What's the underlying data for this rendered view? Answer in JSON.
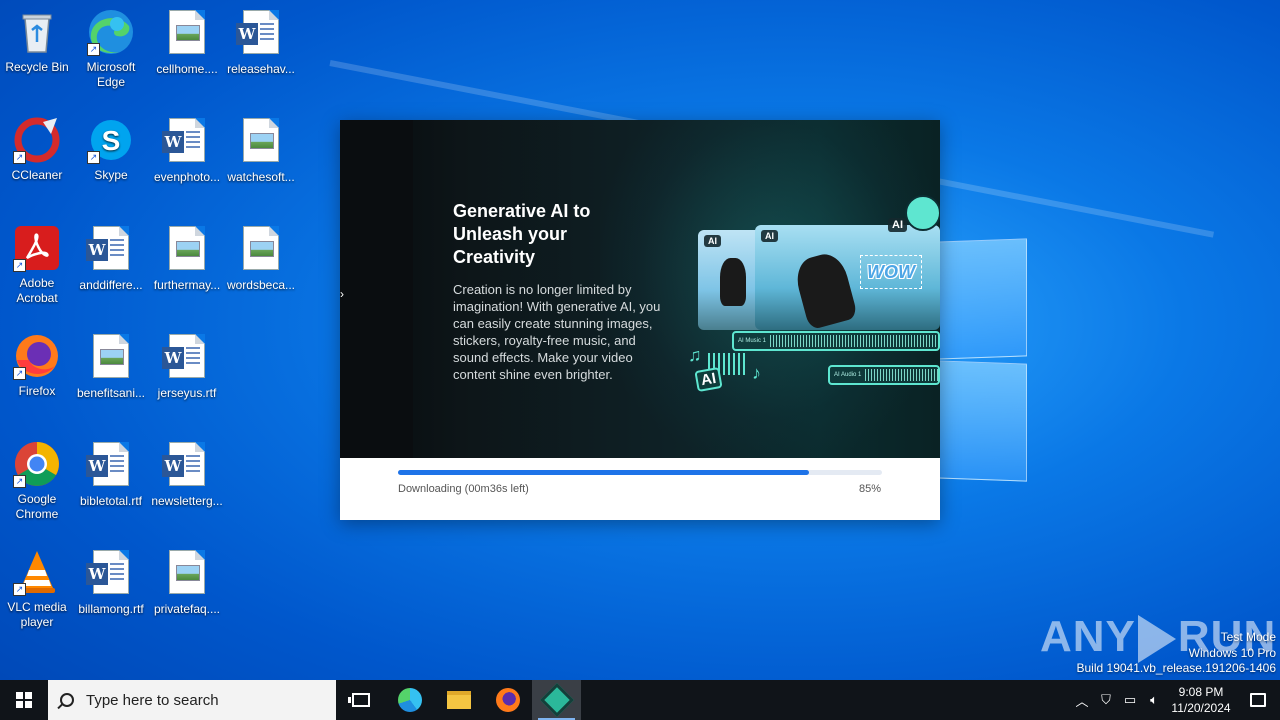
{
  "desktop": {
    "icons": [
      {
        "name": "recycle-bin",
        "label": "Recycle Bin"
      },
      {
        "name": "microsoft-edge",
        "label": "Microsoft Edge"
      },
      {
        "name": "cellhome",
        "label": "cellhome...."
      },
      {
        "name": "releasehav",
        "label": "releasehav..."
      },
      {
        "name": "ccleaner",
        "label": "CCleaner"
      },
      {
        "name": "skype",
        "label": "Skype"
      },
      {
        "name": "evenphoto",
        "label": "evenphoto..."
      },
      {
        "name": "watchesoft",
        "label": "watchesoft..."
      },
      {
        "name": "adobe-acrobat",
        "label": "Adobe Acrobat"
      },
      {
        "name": "anddiffere",
        "label": "anddiffere..."
      },
      {
        "name": "furthermay",
        "label": "furthermay..."
      },
      {
        "name": "wordsbeca",
        "label": "wordsbeca..."
      },
      {
        "name": "firefox",
        "label": "Firefox"
      },
      {
        "name": "benefitsani",
        "label": "benefitsani..."
      },
      {
        "name": "jerseyus",
        "label": "jerseyus.rtf"
      },
      {
        "name": "google-chrome",
        "label": "Google Chrome"
      },
      {
        "name": "bibletotal",
        "label": "bibletotal.rtf"
      },
      {
        "name": "newsletterg",
        "label": "newsletterg..."
      },
      {
        "name": "vlc",
        "label": "VLC media player"
      },
      {
        "name": "billamong",
        "label": "billamong.rtf"
      },
      {
        "name": "privatefaq",
        "label": "privatefaq...."
      }
    ]
  },
  "installer": {
    "title": "Generative AI to\nUnleash your\nCreativity",
    "description": "Creation is no longer limited by imagination! With generative AI, you can easily create stunning images, stickers, royalty-free music, and sound effects. Make your video content shine even brighter.",
    "illustration": {
      "ai_tag": "AI",
      "sticker_text": "WOW",
      "track1_label": "AI Music 1",
      "track2_label": "AI Audio 1",
      "music_ai_label": "AI"
    },
    "status": "Downloading (00m36s left)",
    "percent_label": "85%",
    "progress": 0.85
  },
  "watermark": {
    "brand_left": "ANY",
    "brand_right": "RUN",
    "line1": "Test Mode",
    "line2": "Windows 10 Pro",
    "line3": "Build 19041.vb_release.191206-1406"
  },
  "taskbar": {
    "search_placeholder": "Type here to search",
    "time": "9:08 PM",
    "date": "11/20/2024"
  },
  "colors": {
    "accent": "#1e73e8",
    "track_accent": "#5ee6d0"
  }
}
